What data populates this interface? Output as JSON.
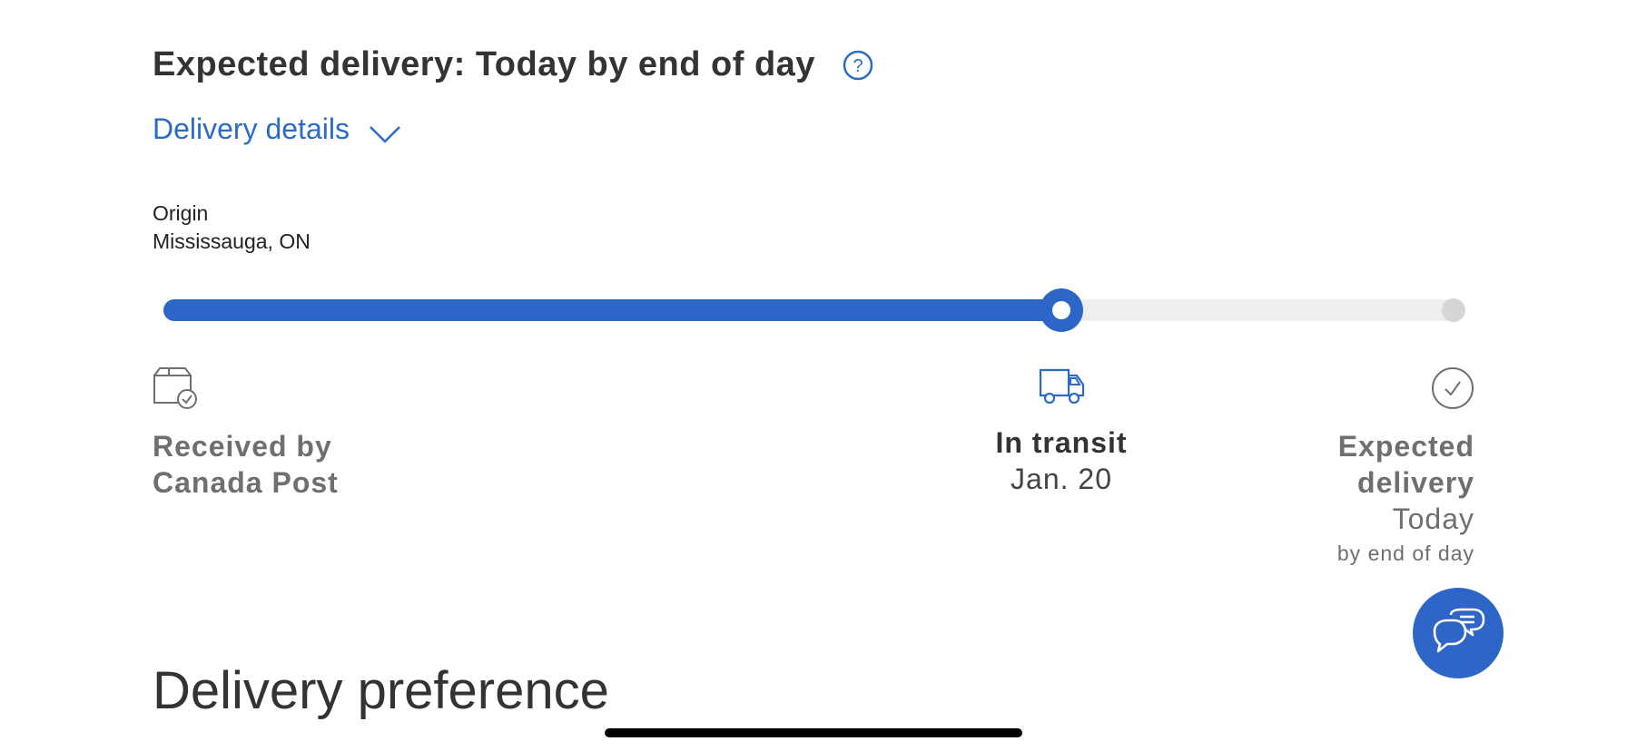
{
  "header": {
    "title": "Expected delivery: Today by end of day",
    "help_icon": "question-circle-icon"
  },
  "details_toggle": {
    "label": "Delivery details",
    "icon": "chevron-down-icon"
  },
  "origin": {
    "label": "Origin",
    "value": "Mississauga, ON"
  },
  "progress": {
    "fraction": 0.69,
    "accent_color": "#2e66c8",
    "track_color": "#eeeeee"
  },
  "steps": [
    {
      "icon": "package-received-icon",
      "label_line1": "Received by",
      "label_line2": "Canada Post"
    },
    {
      "icon": "delivery-truck-icon",
      "label": "In transit",
      "date": "Jan. 20"
    },
    {
      "icon": "check-circle-icon",
      "label_line1": "Expected",
      "label_line2": "delivery",
      "sub1": "Today",
      "sub2": "by end of day"
    }
  ],
  "chat": {
    "icon": "chat-bubbles-icon"
  },
  "section": {
    "heading": "Delivery preference"
  }
}
